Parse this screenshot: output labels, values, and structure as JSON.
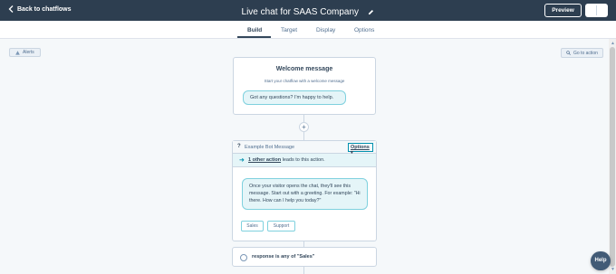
{
  "header": {
    "back_label": "Back to chatflows",
    "title": "Live chat for SAAS Company",
    "preview_label": "Preview"
  },
  "tabs": [
    {
      "label": "Build",
      "active": true
    },
    {
      "label": "Target",
      "active": false
    },
    {
      "label": "Display",
      "active": false
    },
    {
      "label": "Options",
      "active": false
    }
  ],
  "canvas": {
    "alerts_label": "Alerts",
    "goto_label": "Go to action"
  },
  "welcome": {
    "title": "Welcome message",
    "subtitle": "Start your chatflow with a welcome message",
    "bubble": "Got any questions? I'm happy to help."
  },
  "bot_message": {
    "marker": "?",
    "name": "Example Bot Message",
    "options_label": "Options",
    "lead_link": "1 other action",
    "lead_rest": " leads to this action.",
    "bubble": "Once your visitor opens the chat, they'll see this message. Start out with a greeting. For example: \"Hi there. How can I help you today?\"",
    "quick_replies": [
      "Sales",
      "Support"
    ]
  },
  "branch": {
    "label": "response is any of \"Sales\""
  },
  "help_label": "Help",
  "colors": {
    "topbar": "#2d3e50",
    "accent": "#0091ae",
    "bubble_bg": "#e5f5f8",
    "bubble_border": "#7fd1de"
  }
}
